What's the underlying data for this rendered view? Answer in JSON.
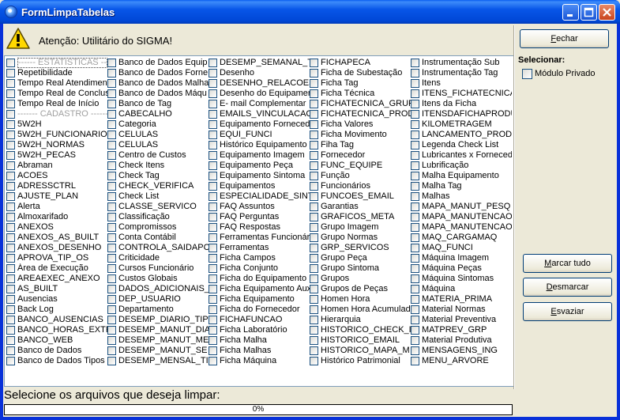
{
  "window": {
    "title": "FormLimpaTabelas"
  },
  "header": {
    "attention": "Atenção:  Utilitário do SIGMA!"
  },
  "columns": [
    [
      "------ ESTATÍSTICAS ----",
      "Repetibilidade",
      "Tempo Real Atendimento",
      "Tempo Real de Conclusão",
      "Tempo Real de Início",
      "------- CADASTRO -------",
      "5W2H",
      "5W2H_FUNCIONARIO",
      "5W2H_NORMAS",
      "5W2H_PECAS",
      "Abraman",
      "ACOES",
      "ADRESSCTRL",
      "AJUSTE_PLAN",
      "Alerta",
      "Almoxarifado",
      "ANEXOS",
      "ANEXOS_AS_BUILT",
      "ANEXOS_DESENHO",
      "APROVA_TIP_OS",
      "Área de Execução",
      "AREAEXEC_ANEXO",
      "AS_BUILT",
      "Ausencias",
      "Back Log",
      "BANCO_AUSENCIAS",
      "BANCO_HORAS_EXTRA",
      "BANCO_WEB",
      "Banco de Dados",
      "Banco de Dados Tipos"
    ],
    [
      "Banco de Dados Equip",
      "Banco de Dados Forne",
      "Banco de Dados Malha",
      "Banco de Dados Máqu",
      "Banco de Tag",
      "CABECALHO",
      "Categoria",
      "CELULAS",
      "CELULAS",
      "Centro de Custos",
      "Check Itens",
      "Check Tag",
      "CHECK_VERIFICA",
      "Check List",
      "CLASSE_SERVICO",
      "Classificação",
      "Compromissos",
      "Conta Contábil",
      "CONTROLA_SAIDAPC",
      "Criticidade",
      "Cursos Funcionário",
      "Custos Globais",
      "DADOS_ADICIONAIS_",
      "DEP_USUARIO",
      "Departamento",
      "DESEMP_DIARIO_TIP",
      "DESEMP_MANUT_DIA",
      "DESEMP_MANUT_ME",
      "DESEMP_MANUT_SE",
      "DESEMP_MENSAL_TI"
    ],
    [
      "DESEMP_SEMANAL_T",
      "Desenho",
      "DESENHO_RELACOES",
      "Desenho do Equipamento",
      "E- mail Complementar",
      "EMAILS_VINCULACAO",
      "Equipamento Fornecedor",
      "EQUI_FUNCI",
      "Histórico Equipamento",
      "Equipamento Imagem",
      "Equipamento Peça",
      "Equipamento Sintoma",
      "Equipamentos",
      "ESPECIALIDADE_SINT",
      "FAQ Assuntos",
      "FAQ Perguntas",
      "FAQ Respostas",
      "Ferramentas Funcionário",
      "Ferramentas",
      "Ficha Campos",
      "Ficha Conjunto",
      "Ficha do Equipamento",
      "Ficha Equipamento Aux",
      "Ficha Equipamento",
      "Ficha do Fornecedor",
      "FICHAFUNCAO",
      "Ficha  Laboratório",
      "Ficha Malha",
      "Ficha Malhas",
      "Ficha Máquina"
    ],
    [
      "FICHAPECA",
      "Ficha de Subestação",
      "Ficha Tag",
      "Ficha Técnica",
      "FICHATECNICA_GRUP",
      "FICHATECNICA_PROD",
      "Ficha Valores",
      "Ficha Movimento",
      "Fiha Tag",
      "Fornecedor",
      "FUNC_EQUIPE",
      "Função",
      "Funcionários",
      "FUNCOES_EMAIL",
      "Garantias",
      "GRAFICOS_META",
      "Grupo Imagem",
      "Grupo Normas",
      "GRP_SERVICOS",
      "Grupo Peça",
      "Grupo Sintoma",
      "Grupos",
      "Grupos de Peças",
      "Homen Hora",
      "Homen Hora Acumulado",
      "Hierarquia",
      "HISTORICO_CHECK_I",
      "HISTORICO_EMAIL",
      "HISTORICO_MAPA_M",
      "Histórico Patrimonial"
    ],
    [
      "Instrumentação Sub",
      "Instrumentação Tag",
      "Itens",
      "ITENS_FICHATECNICA",
      "Itens da Ficha",
      "ITENSDAFICHAPRODU",
      "KILOMETRAGEM",
      "LANCAMENTO_PROD",
      "Legenda Check List",
      "Lubricantes x Forneced",
      "Lubrificação",
      "Malha Equipamento",
      "Malha Tag",
      "Malhas",
      "MAPA_MANUT_PESQ",
      "MAPA_MANUTENCAO",
      "MAPA_MANUTENCAO",
      "MAQ_CARGAMAQ",
      "MAQ_FUNCI",
      "Máquina Imagem",
      "Máquina Peças",
      "Máquina Sintomas",
      "Máquina",
      "MATERIA_PRIMA",
      "Material Normas",
      "Material Preventiva",
      "MATPREV_GRP",
      "Material Produtiva",
      "MENSAGENS_ING",
      "MENU_ARVORE"
    ]
  ],
  "buttons": {
    "close": {
      "ul": "F",
      "rest": "echar"
    },
    "mark_all": {
      "ul": "M",
      "rest": "arcar tudo"
    },
    "unmark": {
      "ul": "D",
      "rest": "esmarcar"
    },
    "empty": {
      "ul": "E",
      "rest": "svaziar"
    }
  },
  "select": {
    "label": "Selecionar:",
    "private_module": "Módulo Privado"
  },
  "status": {
    "text": "Selecione os arquivos que deseja limpar:",
    "progress_label": "0%",
    "progress_value": 0
  }
}
